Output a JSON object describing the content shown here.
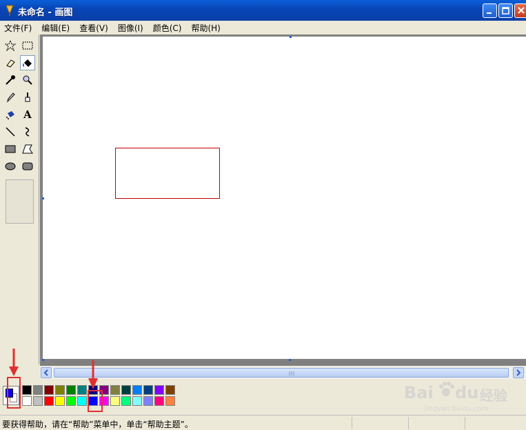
{
  "window": {
    "title": "未命名 - 画图"
  },
  "menu": [
    "文件(F)",
    "编辑(E)",
    "查看(V)",
    "图像(I)",
    "颜色(C)",
    "帮助(H)"
  ],
  "tools": [
    {
      "name": "free-select-icon"
    },
    {
      "name": "rect-select-icon"
    },
    {
      "name": "eraser-icon"
    },
    {
      "name": "fill-bucket-icon",
      "active": true
    },
    {
      "name": "color-picker-icon"
    },
    {
      "name": "magnifier-icon"
    },
    {
      "name": "pencil-icon"
    },
    {
      "name": "brush-icon"
    },
    {
      "name": "airbrush-icon"
    },
    {
      "name": "text-tool-icon",
      "glyph": "A"
    },
    {
      "name": "line-icon"
    },
    {
      "name": "curve-icon"
    },
    {
      "name": "rectangle-icon"
    },
    {
      "name": "polygon-icon"
    },
    {
      "name": "ellipse-icon"
    },
    {
      "name": "rounded-rect-icon"
    }
  ],
  "colors": {
    "foreground": "#0000ff",
    "background": "#ffffff",
    "accent_red": "#c00000",
    "palette_top": [
      "#000000",
      "#808080",
      "#800000",
      "#808000",
      "#008000",
      "#008080",
      "#000080",
      "#800080",
      "#808040",
      "#004040",
      "#0080ff",
      "#004080",
      "#8000ff",
      "#804000"
    ],
    "palette_bottom": [
      "#ffffff",
      "#c0c0c0",
      "#ff0000",
      "#ffff00",
      "#00ff00",
      "#00ffff",
      "#0000ff",
      "#ff00ff",
      "#ffff80",
      "#00ff80",
      "#80ffff",
      "#8080ff",
      "#ff0080",
      "#ff8040"
    ]
  },
  "status": {
    "text": "要获得帮助，请在“帮助”菜单中，单击“帮助主题”。"
  },
  "watermark": {
    "brand": "Bai",
    "brand2": "du",
    "cn": "经验",
    "url": "jingyan.baidu.com"
  }
}
